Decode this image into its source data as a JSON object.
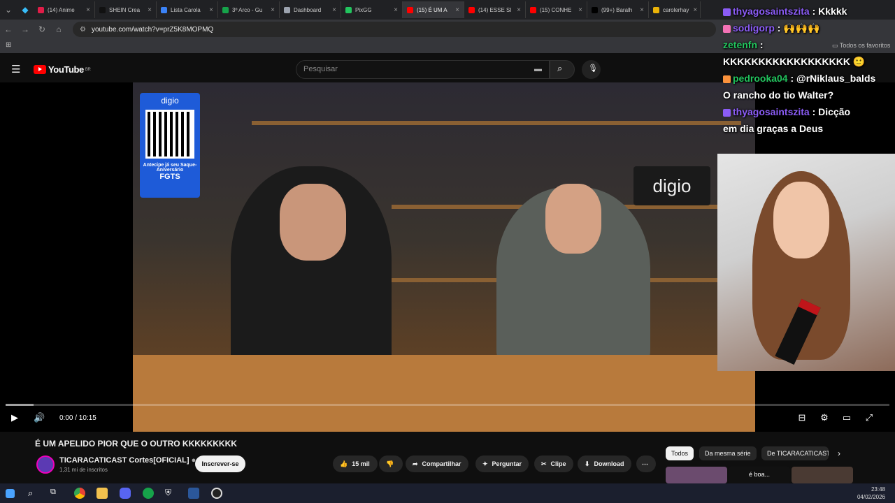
{
  "browser": {
    "tabs": [
      {
        "label": "(14) Anime",
        "color": "#e11d48"
      },
      {
        "label": "SHEIN Crea",
        "color": "#111111"
      },
      {
        "label": "Lista Carola",
        "color": "#3b82f6"
      },
      {
        "label": "3º Arco - Gu",
        "color": "#16a34a"
      },
      {
        "label": "Dashboard",
        "color": "#9ca3af"
      },
      {
        "label": "PixGG",
        "color": "#22c55e"
      },
      {
        "label": "(15) É UM A",
        "color": "#ff0000",
        "active": true
      },
      {
        "label": "(14) ESSE SI",
        "color": "#ff0000"
      },
      {
        "label": "(15) CONHE",
        "color": "#ff0000"
      },
      {
        "label": "(99+) Baralh",
        "color": "#000000"
      },
      {
        "label": "carolerhay",
        "color": "#eab308"
      }
    ],
    "url": "youtube.com/watch?v=prZ5K8MOPMQ",
    "bookmarks_label": "Todos os favoritos"
  },
  "youtube": {
    "logo_text": "YouTube",
    "region": "BR",
    "search_placeholder": "Pesquisar",
    "video": {
      "sponsor_brand": "digio",
      "sponsor_line1": "Antecipe já seu Saque-Aniversário",
      "sponsor_line2": "FGTS",
      "sign_text": "digio",
      "time": "0:00 / 10:15"
    },
    "title": "É UM APELIDO PIOR QUE O OUTRO KKKKKKKKK",
    "channel": {
      "name": "TICARACATICAST Cortes[OFICIAL]",
      "subs": "1,31 mi de inscritos",
      "subscribe": "Inscrever-se"
    },
    "actions": {
      "likes": "15 mil",
      "share": "Compartilhar",
      "ask": "Perguntar",
      "clip": "Clipe",
      "download": "Download"
    },
    "chips": [
      "Todos",
      "Da mesma série",
      "De TICARACATICAST"
    ],
    "thumb_text": "é boa..."
  },
  "chat": [
    {
      "user": "thyagosaintszita",
      "text": ": Kkkkk"
    },
    {
      "user": "sodigorp",
      "text": ":"
    },
    {
      "user": "zetenfn",
      "text": ":"
    },
    {
      "user": "",
      "text": "KKKKKKKKKKKKKKKKKK"
    },
    {
      "user": "pedrooka04",
      "text": ": @rNiklaus_balds"
    },
    {
      "user": "",
      "text": "O rancho do tio Walter?"
    },
    {
      "user": "thyagosaintszita",
      "text": ": Dicção"
    },
    {
      "user": "",
      "text": "em dia graças a Deus"
    }
  ],
  "taskbar": {
    "time": "23:48",
    "date": "04/02/2026"
  }
}
